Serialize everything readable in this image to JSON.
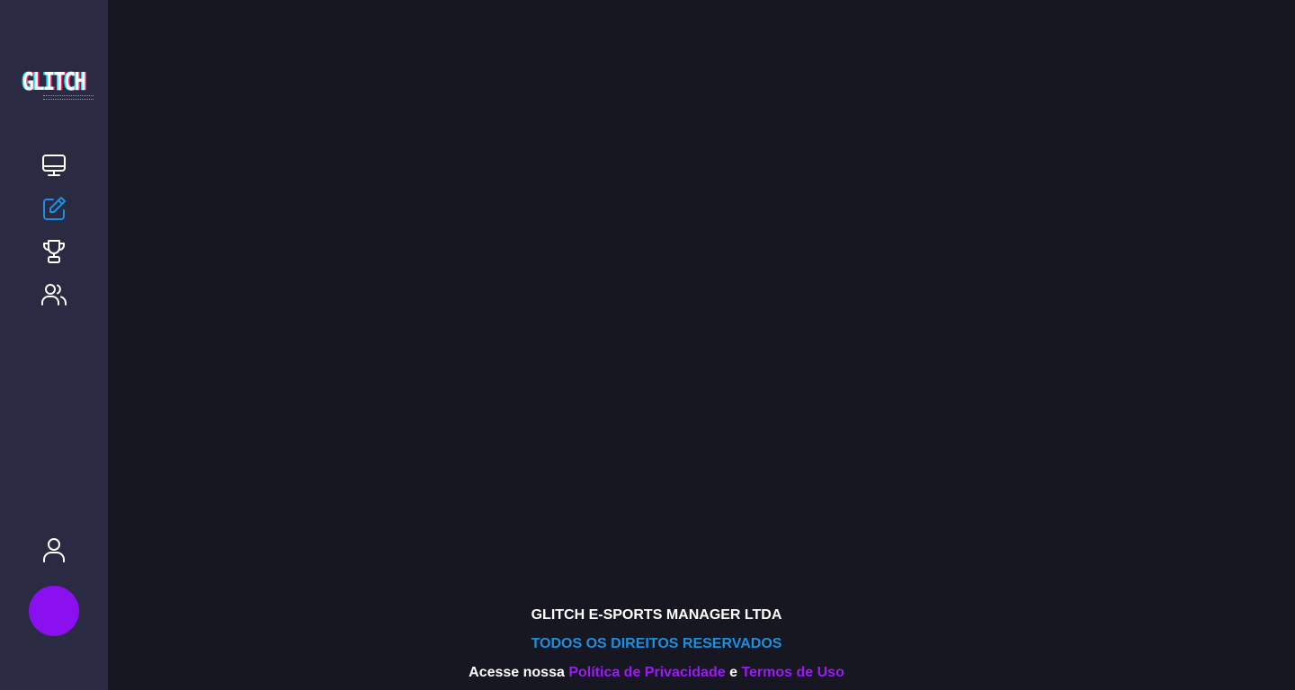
{
  "sidebar": {
    "logo_text": "GLITCH",
    "nav": [
      {
        "icon": "monitor-icon",
        "active": false
      },
      {
        "icon": "edit-icon",
        "active": true
      },
      {
        "icon": "trophy-icon",
        "active": false
      },
      {
        "icon": "users-icon",
        "active": false
      }
    ],
    "profile_icon": "user-icon"
  },
  "footer": {
    "company": "GLITCH E-SPORTS MANAGER LTDA",
    "rights": "TODOS OS DIREITOS RESERVADOS",
    "legal_prefix": "Acesse nossa",
    "privacy_link": "Política de Privacidade",
    "conjunction": "e",
    "terms_link": "Termos de Uso"
  },
  "colors": {
    "background": "#171721",
    "sidebar": "#2a2a42",
    "active_icon": "#1b8fe0",
    "accent_purple": "#9a1cf2",
    "avatar": "#8a10f0"
  }
}
